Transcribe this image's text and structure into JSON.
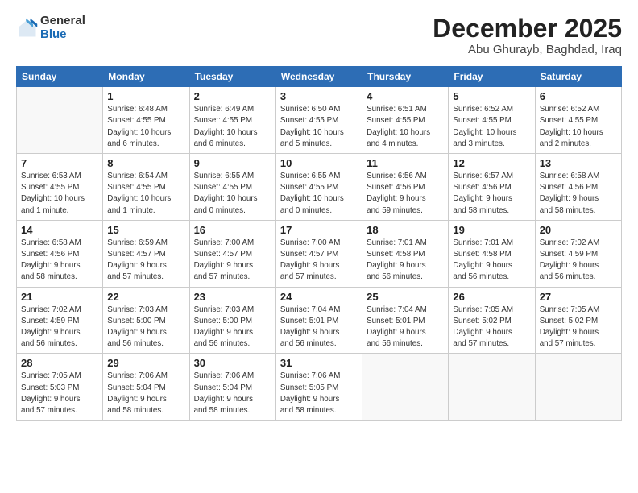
{
  "header": {
    "logo_general": "General",
    "logo_blue": "Blue",
    "month_title": "December 2025",
    "location": "Abu Ghurayb, Baghdad, Iraq"
  },
  "weekdays": [
    "Sunday",
    "Monday",
    "Tuesday",
    "Wednesday",
    "Thursday",
    "Friday",
    "Saturday"
  ],
  "weeks": [
    [
      {
        "day": "",
        "info": ""
      },
      {
        "day": "1",
        "info": "Sunrise: 6:48 AM\nSunset: 4:55 PM\nDaylight: 10 hours\nand 6 minutes."
      },
      {
        "day": "2",
        "info": "Sunrise: 6:49 AM\nSunset: 4:55 PM\nDaylight: 10 hours\nand 6 minutes."
      },
      {
        "day": "3",
        "info": "Sunrise: 6:50 AM\nSunset: 4:55 PM\nDaylight: 10 hours\nand 5 minutes."
      },
      {
        "day": "4",
        "info": "Sunrise: 6:51 AM\nSunset: 4:55 PM\nDaylight: 10 hours\nand 4 minutes."
      },
      {
        "day": "5",
        "info": "Sunrise: 6:52 AM\nSunset: 4:55 PM\nDaylight: 10 hours\nand 3 minutes."
      },
      {
        "day": "6",
        "info": "Sunrise: 6:52 AM\nSunset: 4:55 PM\nDaylight: 10 hours\nand 2 minutes."
      }
    ],
    [
      {
        "day": "7",
        "info": "Sunrise: 6:53 AM\nSunset: 4:55 PM\nDaylight: 10 hours\nand 1 minute."
      },
      {
        "day": "8",
        "info": "Sunrise: 6:54 AM\nSunset: 4:55 PM\nDaylight: 10 hours\nand 1 minute."
      },
      {
        "day": "9",
        "info": "Sunrise: 6:55 AM\nSunset: 4:55 PM\nDaylight: 10 hours\nand 0 minutes."
      },
      {
        "day": "10",
        "info": "Sunrise: 6:55 AM\nSunset: 4:55 PM\nDaylight: 10 hours\nand 0 minutes."
      },
      {
        "day": "11",
        "info": "Sunrise: 6:56 AM\nSunset: 4:56 PM\nDaylight: 9 hours\nand 59 minutes."
      },
      {
        "day": "12",
        "info": "Sunrise: 6:57 AM\nSunset: 4:56 PM\nDaylight: 9 hours\nand 58 minutes."
      },
      {
        "day": "13",
        "info": "Sunrise: 6:58 AM\nSunset: 4:56 PM\nDaylight: 9 hours\nand 58 minutes."
      }
    ],
    [
      {
        "day": "14",
        "info": "Sunrise: 6:58 AM\nSunset: 4:56 PM\nDaylight: 9 hours\nand 58 minutes."
      },
      {
        "day": "15",
        "info": "Sunrise: 6:59 AM\nSunset: 4:57 PM\nDaylight: 9 hours\nand 57 minutes."
      },
      {
        "day": "16",
        "info": "Sunrise: 7:00 AM\nSunset: 4:57 PM\nDaylight: 9 hours\nand 57 minutes."
      },
      {
        "day": "17",
        "info": "Sunrise: 7:00 AM\nSunset: 4:57 PM\nDaylight: 9 hours\nand 57 minutes."
      },
      {
        "day": "18",
        "info": "Sunrise: 7:01 AM\nSunset: 4:58 PM\nDaylight: 9 hours\nand 56 minutes."
      },
      {
        "day": "19",
        "info": "Sunrise: 7:01 AM\nSunset: 4:58 PM\nDaylight: 9 hours\nand 56 minutes."
      },
      {
        "day": "20",
        "info": "Sunrise: 7:02 AM\nSunset: 4:59 PM\nDaylight: 9 hours\nand 56 minutes."
      }
    ],
    [
      {
        "day": "21",
        "info": "Sunrise: 7:02 AM\nSunset: 4:59 PM\nDaylight: 9 hours\nand 56 minutes."
      },
      {
        "day": "22",
        "info": "Sunrise: 7:03 AM\nSunset: 5:00 PM\nDaylight: 9 hours\nand 56 minutes."
      },
      {
        "day": "23",
        "info": "Sunrise: 7:03 AM\nSunset: 5:00 PM\nDaylight: 9 hours\nand 56 minutes."
      },
      {
        "day": "24",
        "info": "Sunrise: 7:04 AM\nSunset: 5:01 PM\nDaylight: 9 hours\nand 56 minutes."
      },
      {
        "day": "25",
        "info": "Sunrise: 7:04 AM\nSunset: 5:01 PM\nDaylight: 9 hours\nand 56 minutes."
      },
      {
        "day": "26",
        "info": "Sunrise: 7:05 AM\nSunset: 5:02 PM\nDaylight: 9 hours\nand 57 minutes."
      },
      {
        "day": "27",
        "info": "Sunrise: 7:05 AM\nSunset: 5:02 PM\nDaylight: 9 hours\nand 57 minutes."
      }
    ],
    [
      {
        "day": "28",
        "info": "Sunrise: 7:05 AM\nSunset: 5:03 PM\nDaylight: 9 hours\nand 57 minutes."
      },
      {
        "day": "29",
        "info": "Sunrise: 7:06 AM\nSunset: 5:04 PM\nDaylight: 9 hours\nand 58 minutes."
      },
      {
        "day": "30",
        "info": "Sunrise: 7:06 AM\nSunset: 5:04 PM\nDaylight: 9 hours\nand 58 minutes."
      },
      {
        "day": "31",
        "info": "Sunrise: 7:06 AM\nSunset: 5:05 PM\nDaylight: 9 hours\nand 58 minutes."
      },
      {
        "day": "",
        "info": ""
      },
      {
        "day": "",
        "info": ""
      },
      {
        "day": "",
        "info": ""
      }
    ]
  ]
}
